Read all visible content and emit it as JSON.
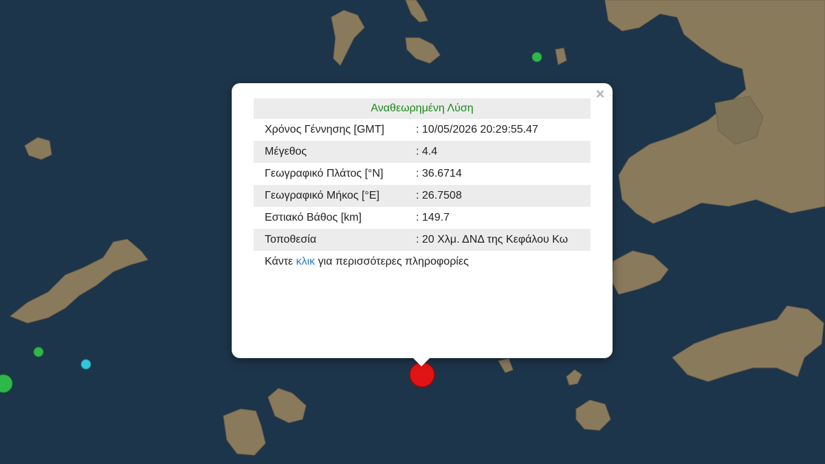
{
  "popup": {
    "title": "Αναθεωρημένη Λύση",
    "close_label": "×",
    "rows": [
      {
        "label": "Χρόνος Γέννησης [GMT]",
        "value": ": 10/05/2026 20:29:55.47"
      },
      {
        "label": "Μέγεθος",
        "value": ": 4.4"
      },
      {
        "label": "Γεωγραφικό Πλάτος [°N]",
        "value": ": 36.6714"
      },
      {
        "label": "Γεωγραφικό Μήκος [°E]",
        "value": ": 26.7508"
      },
      {
        "label": "Εστιακό Βάθος [km]",
        "value": ": 149.7"
      },
      {
        "label": "Τοποθεσία",
        "value": ": 20 Χλμ. ΔΝΔ της Κεφάλου Κω"
      }
    ],
    "footer": {
      "prefix": "Κάντε ",
      "link": "κλικ",
      "suffix": " για περισσότερες πληροφορίες"
    }
  },
  "colors": {
    "sea": "#1b3247",
    "land": "#8a7a5c",
    "title_green": "#1a8a1a",
    "link_blue": "#2a7bbf",
    "event_red": "#e01414",
    "marker_green": "#2fb84a",
    "marker_cyan": "#33c6d8"
  },
  "markers": [
    {
      "type": "event",
      "color": "red",
      "selected": true
    },
    {
      "type": "quake",
      "color": "green"
    },
    {
      "type": "quake",
      "color": "green"
    },
    {
      "type": "quake",
      "color": "cyan"
    },
    {
      "type": "quake",
      "color": "green"
    }
  ]
}
